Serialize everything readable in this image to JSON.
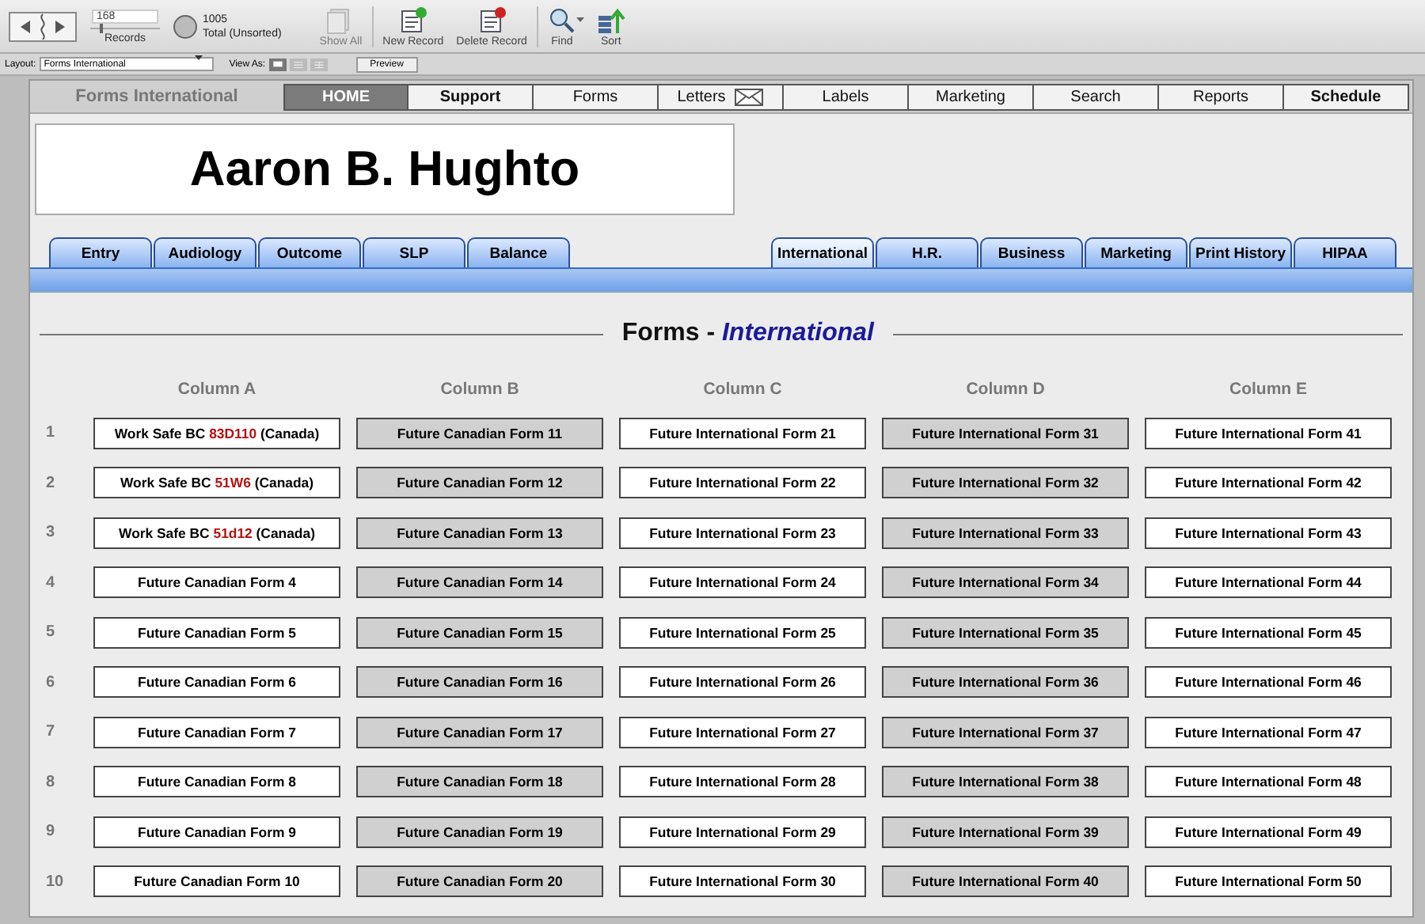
{
  "toolbar": {
    "record_number": "168",
    "records_label": "Records",
    "total": "1005",
    "total_label": "Total (Unsorted)",
    "buttons": [
      {
        "label": "Show All",
        "kind": "showall",
        "disabled": true
      },
      {
        "label": "New Record",
        "kind": "new",
        "disabled": false
      },
      {
        "label": "Delete Record",
        "kind": "delete",
        "disabled": false
      },
      {
        "label": "Find",
        "kind": "find",
        "disabled": false
      },
      {
        "label": "Sort",
        "kind": "sort",
        "disabled": false
      }
    ]
  },
  "layout_bar": {
    "layout_label": "Layout:",
    "layout_value": "Forms International",
    "view_label": "View As:",
    "views": [
      {
        "kind": "form",
        "selected": true
      },
      {
        "kind": "list",
        "selected": false
      },
      {
        "kind": "table",
        "selected": false
      }
    ],
    "preview_button": "Preview"
  },
  "header": {
    "app_title": "Forms International",
    "nav": [
      {
        "label": "HOME",
        "selected": true,
        "bold": true,
        "kind": "text"
      },
      {
        "label": "Support",
        "selected": false,
        "bold": true,
        "kind": "text"
      },
      {
        "label": "Forms",
        "selected": false,
        "bold": false,
        "kind": "text"
      },
      {
        "label": "Letters",
        "selected": false,
        "bold": false,
        "kind": "icon"
      },
      {
        "label": "Labels",
        "selected": false,
        "bold": false,
        "kind": "text"
      },
      {
        "label": "Marketing",
        "selected": false,
        "bold": false,
        "kind": "text"
      },
      {
        "label": "Search",
        "selected": false,
        "bold": false,
        "kind": "text"
      },
      {
        "label": "Reports",
        "selected": false,
        "bold": false,
        "kind": "text"
      },
      {
        "label": "Schedule",
        "selected": false,
        "bold": true,
        "kind": "text"
      }
    ]
  },
  "patient_name": "Aaron B. Hughto",
  "subtabs_left": [
    {
      "label": "Entry",
      "selected": false
    },
    {
      "label": "Audiology",
      "selected": false
    },
    {
      "label": "Outcome",
      "selected": false
    },
    {
      "label": "SLP",
      "selected": false
    },
    {
      "label": "Balance",
      "selected": false
    }
  ],
  "subtabs_right": [
    {
      "label": "International",
      "selected": true
    },
    {
      "label": "H.R.",
      "selected": false
    },
    {
      "label": "Business",
      "selected": false
    },
    {
      "label": "Marketing",
      "selected": false
    },
    {
      "label": "Print History",
      "selected": false
    },
    {
      "label": "HIPAA",
      "selected": false
    }
  ],
  "section": {
    "title": "Forms - ",
    "title_em": "International"
  },
  "table": {
    "columns": [
      {
        "label": "Column A",
        "shaded": false
      },
      {
        "label": "Column B",
        "shaded": true
      },
      {
        "label": "Column C",
        "shaded": false
      },
      {
        "label": "Column D",
        "shaded": true
      },
      {
        "label": "Column E",
        "shaded": false
      }
    ],
    "rows": [
      {
        "number": "1",
        "cells": [
          {
            "text": "Work Safe BC ",
            "code": "83D110",
            "after": " (Canada)"
          },
          {
            "text": "Future Canadian Form 11"
          },
          {
            "text": "Future International Form 21"
          },
          {
            "text": "Future International Form 31"
          },
          {
            "text": "Future International Form 41"
          }
        ]
      },
      {
        "number": "2",
        "cells": [
          {
            "text": "Work Safe BC ",
            "code": "51W6",
            "after": " (Canada)"
          },
          {
            "text": "Future Canadian Form 12"
          },
          {
            "text": "Future International Form 22"
          },
          {
            "text": "Future International Form 32"
          },
          {
            "text": "Future International Form 42"
          }
        ]
      },
      {
        "number": "3",
        "cells": [
          {
            "text": "Work Safe BC ",
            "code": "51d12",
            "after": " (Canada)"
          },
          {
            "text": "Future Canadian Form 13"
          },
          {
            "text": "Future International Form 23"
          },
          {
            "text": "Future International Form 33"
          },
          {
            "text": "Future International Form 43"
          }
        ]
      },
      {
        "number": "4",
        "cells": [
          {
            "text": "Future Canadian Form 4"
          },
          {
            "text": "Future Canadian Form 14"
          },
          {
            "text": "Future International Form 24"
          },
          {
            "text": "Future International Form 34"
          },
          {
            "text": "Future International Form 44"
          }
        ]
      },
      {
        "number": "5",
        "cells": [
          {
            "text": "Future Canadian Form 5"
          },
          {
            "text": "Future Canadian Form 15"
          },
          {
            "text": "Future International Form 25"
          },
          {
            "text": "Future International Form 35"
          },
          {
            "text": "Future International Form 45"
          }
        ]
      },
      {
        "number": "6",
        "cells": [
          {
            "text": "Future Canadian Form 6"
          },
          {
            "text": "Future Canadian Form 16"
          },
          {
            "text": "Future International Form 26"
          },
          {
            "text": "Future International Form 36"
          },
          {
            "text": "Future International Form 46"
          }
        ]
      },
      {
        "number": "7",
        "cells": [
          {
            "text": "Future Canadian Form 7"
          },
          {
            "text": "Future Canadian Form 17"
          },
          {
            "text": "Future International Form 27"
          },
          {
            "text": "Future International Form 37"
          },
          {
            "text": "Future International Form 47"
          }
        ]
      },
      {
        "number": "8",
        "cells": [
          {
            "text": "Future Canadian Form 8"
          },
          {
            "text": "Future Canadian Form 18"
          },
          {
            "text": "Future International Form 28"
          },
          {
            "text": "Future International Form 38"
          },
          {
            "text": "Future International Form 48"
          }
        ]
      },
      {
        "number": "9",
        "cells": [
          {
            "text": "Future Canadian Form 9"
          },
          {
            "text": "Future Canadian Form 19"
          },
          {
            "text": "Future International Form 29"
          },
          {
            "text": "Future International Form 39"
          },
          {
            "text": "Future International Form 49"
          }
        ]
      },
      {
        "number": "10",
        "cells": [
          {
            "text": "Future Canadian Form 10"
          },
          {
            "text": "Future Canadian Form 20"
          },
          {
            "text": "Future International Form 30"
          },
          {
            "text": "Future International Form 40"
          },
          {
            "text": "Future International Form 50"
          }
        ]
      }
    ]
  }
}
